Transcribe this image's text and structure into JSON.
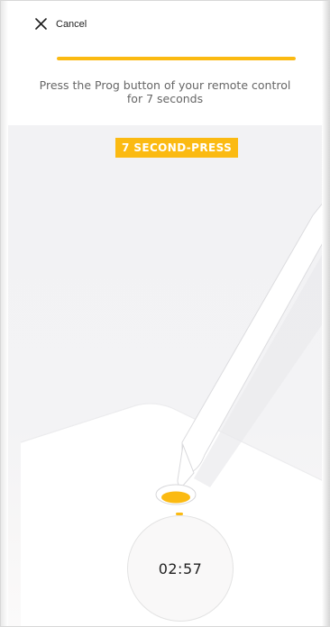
{
  "header": {
    "cancel_label": "Cancel",
    "cancel_icon": "close-icon",
    "progress_fraction": 1.0,
    "instruction": "Press the Prog button of your remote control for 7 seconds"
  },
  "badge": {
    "label": "7 SECOND-PRESS"
  },
  "timer": {
    "value": "02:57"
  },
  "colors": {
    "accent": "#fbba12",
    "text": "#222222",
    "muted": "#666666"
  }
}
